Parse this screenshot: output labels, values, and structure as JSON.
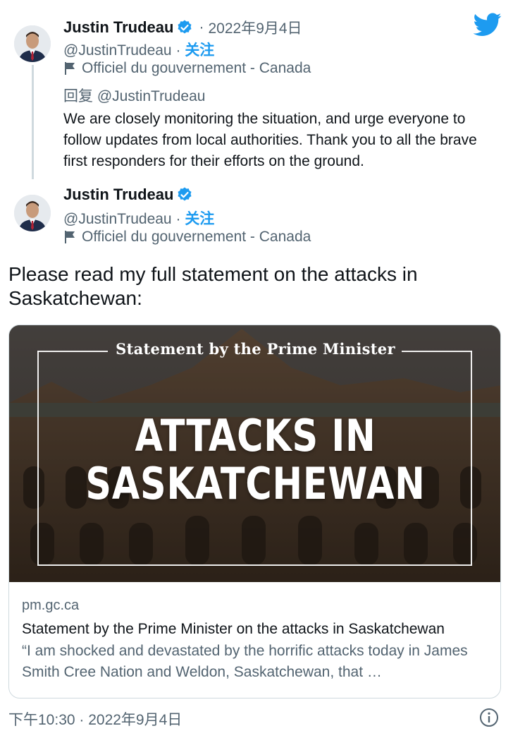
{
  "reply_tweet": {
    "author_name": "Justin Trudeau",
    "date_sep": "·",
    "date": "2022年9月4日",
    "handle": "@JustinTrudeau",
    "follow_sep": "·",
    "follow_label": "关注",
    "gov_label": "Officiel du gouvernement - Canada",
    "reply_to_prefix": "回复",
    "reply_to_handle": "@JustinTrudeau",
    "text": "We are closely monitoring the situation, and urge everyone to follow updates from local authorities. Thank you to all the brave first responders for their efforts on the ground."
  },
  "main_tweet": {
    "author_name": "Justin Trudeau",
    "handle": "@JustinTrudeau",
    "follow_sep": "·",
    "follow_label": "关注",
    "gov_label": "Officiel du gouvernement - Canada",
    "text": "Please read my full statement on the attacks in Saskatchewan:",
    "card": {
      "image_header": "Statement by the Prime Minister",
      "image_title_line1": "ATTACKS IN",
      "image_title_line2": "SASKATCHEWAN",
      "domain": "pm.gc.ca",
      "title": "Statement by the Prime Minister on the attacks in Saskatchewan",
      "description": "“I am shocked and devastated by the horrific attacks today in James Smith Cree Nation and Weldon, Saskatchewan, that …"
    },
    "timestamp": "下午10:30 · 2022年9月4日"
  },
  "icons": {
    "brand": "twitter-bird-icon",
    "verified": "verified-badge-icon",
    "government": "flag-icon",
    "info": "info-icon"
  },
  "colors": {
    "accent": "#1d9bf0",
    "secondary_text": "#536471",
    "primary_text": "#0f1419"
  }
}
